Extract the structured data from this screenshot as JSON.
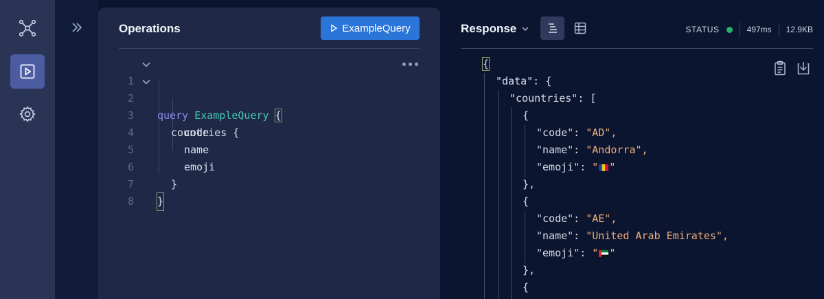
{
  "operations": {
    "title": "Operations",
    "run_button_label": "ExampleQuery",
    "line_numbers": [
      "1",
      "2",
      "3",
      "4",
      "5",
      "6",
      "7",
      "8"
    ],
    "code": {
      "keyword": "query",
      "operation_name": "ExampleQuery",
      "open_brace": "{",
      "line2": "countries {",
      "line3": "code",
      "line4": "name",
      "line5": "emoji",
      "line6": "}",
      "close_brace": "}"
    }
  },
  "response": {
    "title": "Response",
    "status_label": "STATUS",
    "status_color": "#27b36a",
    "time": "497ms",
    "size": "12.9KB",
    "json": {
      "open": "{",
      "data_key": "\"data\": {",
      "countries_key": "\"countries\": [",
      "obj_open": "{",
      "code_key": "\"code\": ",
      "name_key": "\"name\": ",
      "emoji_key": "\"emoji\": ",
      "obj_close": "},",
      "items": [
        {
          "code": "\"AD\",",
          "name": "\"Andorra\",",
          "emoji_flag": "andorra"
        },
        {
          "code": "\"AE\",",
          "name": "\"United Arab Emirates\",",
          "emoji_flag": "uae"
        }
      ]
    }
  },
  "icons": {
    "nav": [
      "graph-icon",
      "play-icon",
      "gear-icon"
    ],
    "expand": "chevrons-right-icon",
    "tools": [
      "clipboard-icon",
      "download-icon"
    ]
  },
  "colors": {
    "accent": "#2b74d8",
    "keyword": "#8e8ef0",
    "operation_name": "#46c6b0",
    "string": "#f0b07a"
  }
}
